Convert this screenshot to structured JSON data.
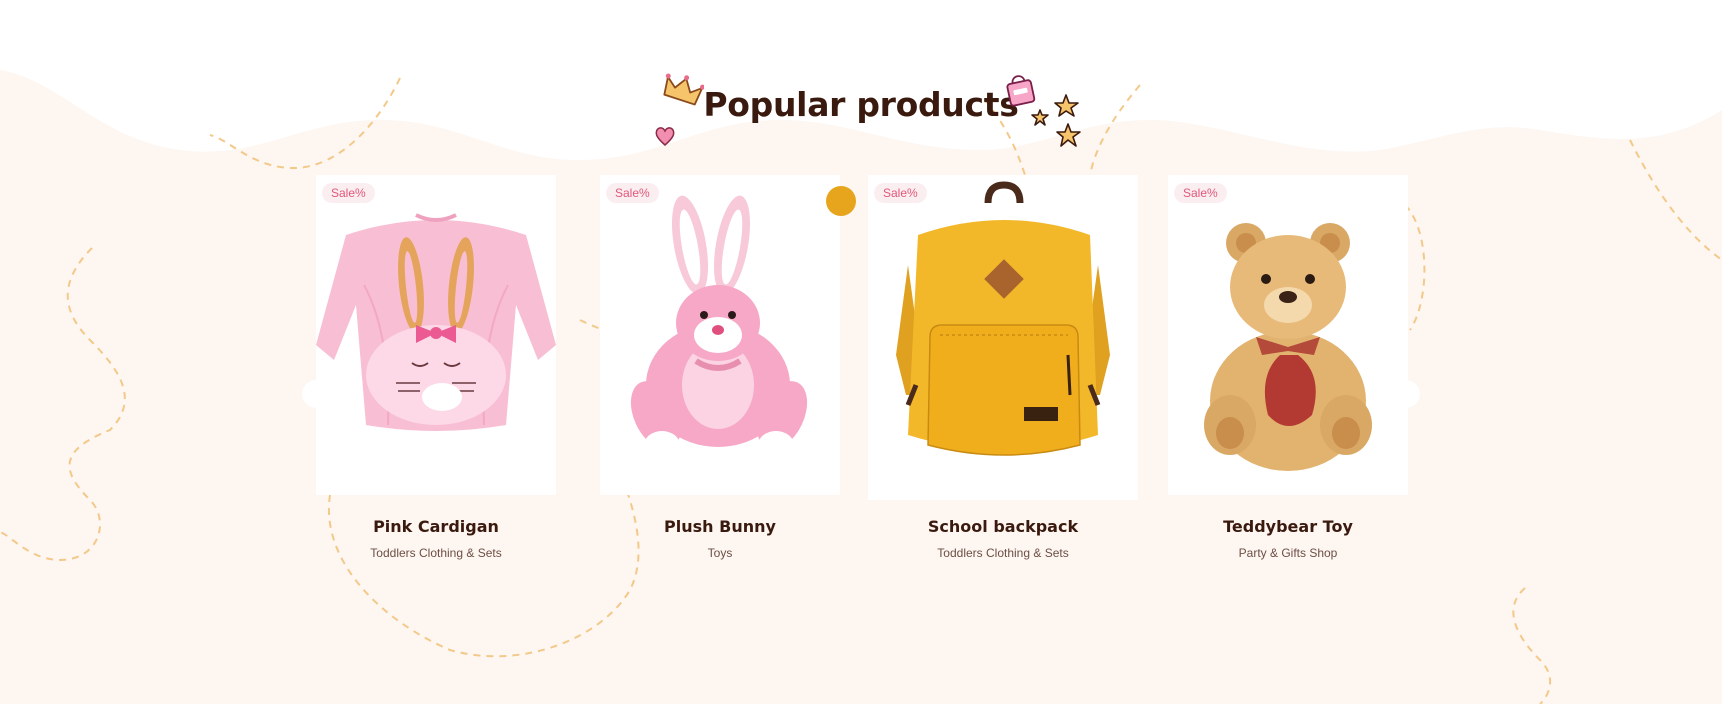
{
  "section": {
    "title": "Popular products"
  },
  "products": [
    {
      "name": "Pink Cardigan",
      "category": "Toddlers Clothing & Sets",
      "badge": "Sale%",
      "image": "pink-bunny-sweater"
    },
    {
      "name": "Plush Bunny",
      "category": "Toys",
      "badge": "Sale%",
      "image": "pink-plush-bunny"
    },
    {
      "name": "School backpack",
      "category": "Toddlers Clothing & Sets",
      "badge": "Sale%",
      "image": "yellow-backpack"
    },
    {
      "name": "Teddybear Toy",
      "category": "Party & Gifts Shop",
      "badge": "Sale%",
      "image": "teddy-bear"
    }
  ],
  "colors": {
    "background": "#fdf6f1",
    "title": "#3a1a0e",
    "badge_text": "#e2587a",
    "badge_bg": "#fbeef1",
    "accent": "#e6a51d",
    "dashed_lines": "#f3c98a"
  },
  "icons": [
    "crown-icon",
    "heart-icon",
    "shopping-bag-icon",
    "stars-icon",
    "wishlist-dot",
    "carousel-prev-icon",
    "carousel-next-icon"
  ]
}
